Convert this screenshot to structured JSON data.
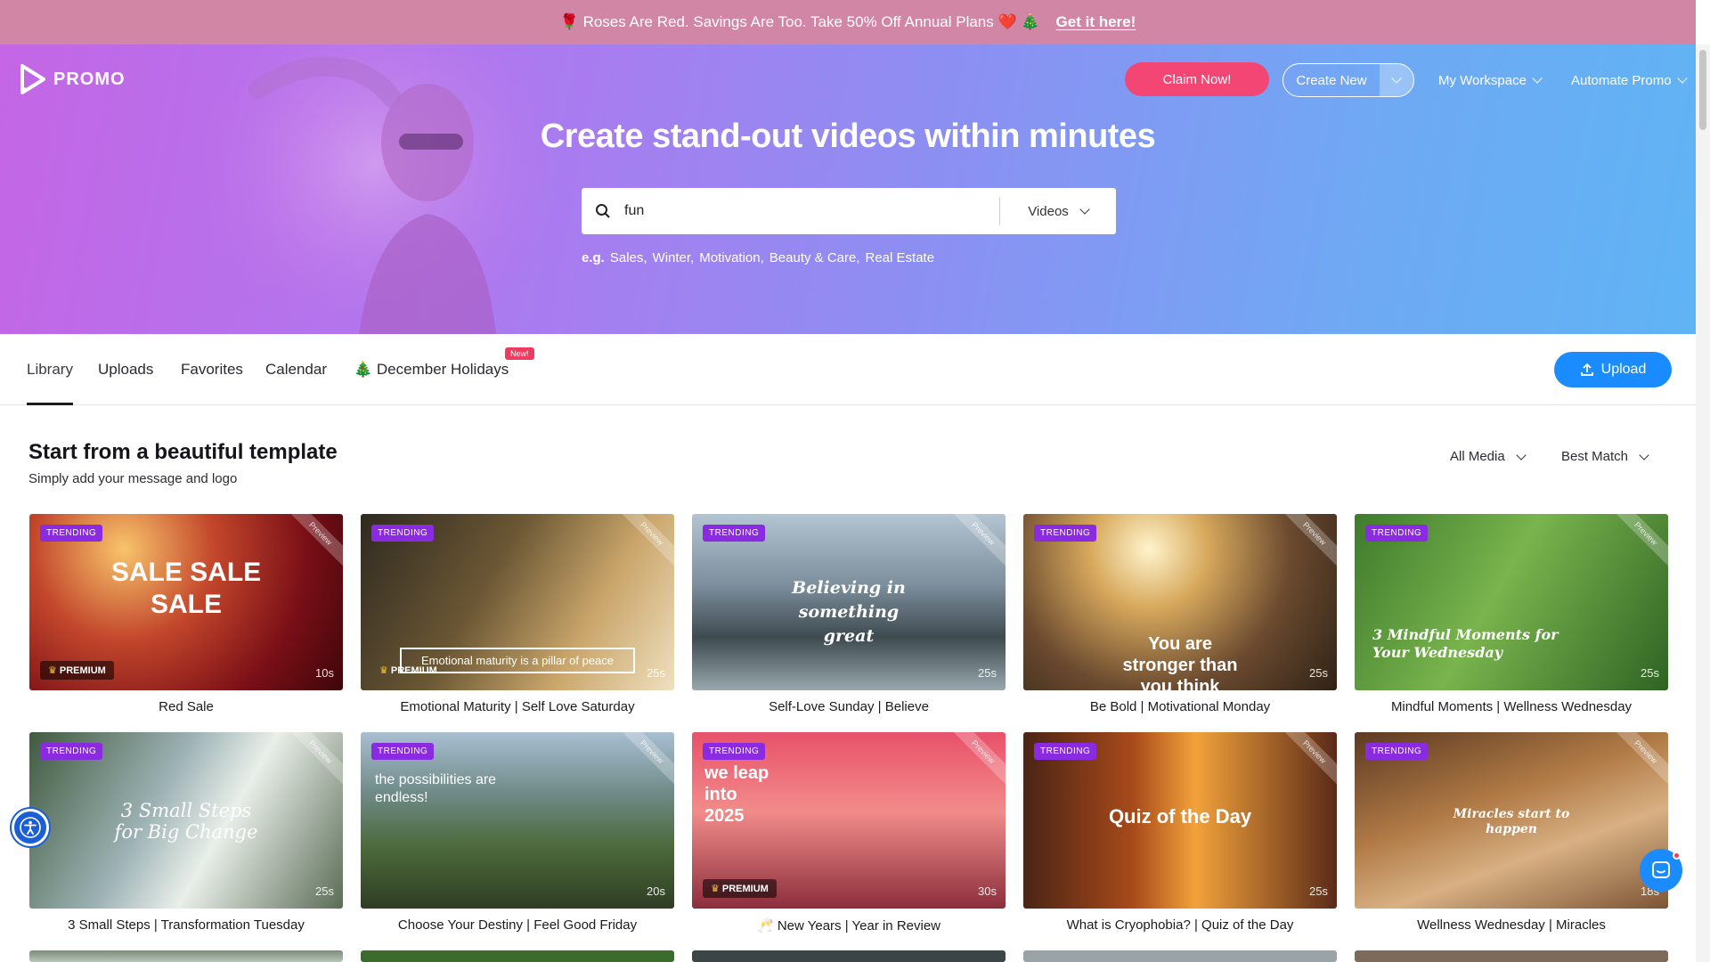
{
  "banner": {
    "text": "🌹 Roses Are Red. Savings Are Too. Take 50% Off Annual Plans ❤️ 🎄",
    "cta": "Get it here!"
  },
  "header": {
    "brand": "PROMO",
    "claim": "Claim Now!",
    "create": "Create New",
    "workspace": "My Workspace",
    "automate": "Automate Promo"
  },
  "hero": {
    "title": "Create stand-out videos within minutes",
    "search_value": "fun",
    "search_type": "Videos",
    "examples_label": "e.g.",
    "examples": [
      "Sales,",
      "Winter,",
      "Motivation,",
      "Beauty & Care,",
      "Real Estate"
    ]
  },
  "tabs": {
    "library": "Library",
    "uploads": "Uploads",
    "favorites": "Favorites",
    "calendar": "Calendar",
    "holidays": "🎄 December Holidays",
    "new_badge": "New!",
    "upload": "Upload"
  },
  "section": {
    "title": "Start from a beautiful template",
    "subtitle": "Simply add your message and logo",
    "filter_media": "All Media",
    "filter_sort": "Best Match"
  },
  "labels": {
    "trending": "TRENDING",
    "premium": "PREMIUM",
    "preview": "Preview"
  },
  "cards": [
    {
      "title": "Red Sale",
      "duration": "10s",
      "overlay": "SALE SALE SALE",
      "premium": true
    },
    {
      "title": "Emotional Maturity | Self Love Saturday",
      "duration": "25s",
      "overlay": "Emotional maturity is a pillar of peace",
      "premium": true
    },
    {
      "title": "Self-Love Sunday | Believe",
      "duration": "25s",
      "overlay": "Believing in something great",
      "premium": false
    },
    {
      "title": "Be Bold | Motivational Monday",
      "duration": "25s",
      "overlay": "You are stronger than you think",
      "premium": false
    },
    {
      "title": "Mindful Moments | Wellness Wednesday",
      "duration": "25s",
      "overlay": "3 Mindful Moments for Your Wednesday",
      "premium": false
    },
    {
      "title": "3 Small Steps | Transformation Tuesday",
      "duration": "25s",
      "overlay": "3 Small Steps for Big Change",
      "premium": false
    },
    {
      "title": "Choose Your Destiny | Feel Good Friday",
      "duration": "20s",
      "overlay": "the possibilities are endless!",
      "premium": false
    },
    {
      "title": "🥂 New Years | Year in Review",
      "duration": "30s",
      "overlay": "we leap into 2025",
      "premium": true
    },
    {
      "title": "What is Cryophobia? | Quiz of the Day",
      "duration": "25s",
      "overlay": "Quiz of the Day",
      "premium": false
    },
    {
      "title": "Wellness Wednesday | Miracles",
      "duration": "18s",
      "overlay": "Miracles start to happen",
      "premium": false
    }
  ]
}
